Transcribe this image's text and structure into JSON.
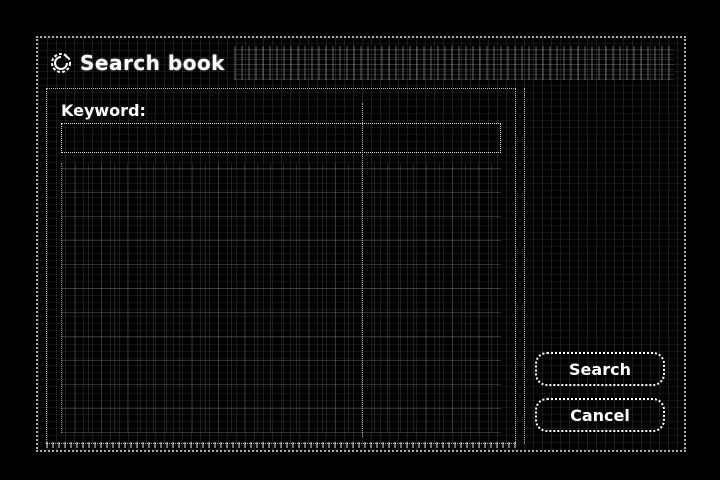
{
  "dialog": {
    "title": "Search book",
    "title_icon": "search-book-icon"
  },
  "form": {
    "keyword_label": "Keyword:",
    "keyword_value": "",
    "keyword_placeholder": ""
  },
  "buttons": {
    "search_label": "Search",
    "cancel_label": "Cancel"
  },
  "colors": {
    "background": "#000000",
    "foreground": "#ffffff"
  }
}
